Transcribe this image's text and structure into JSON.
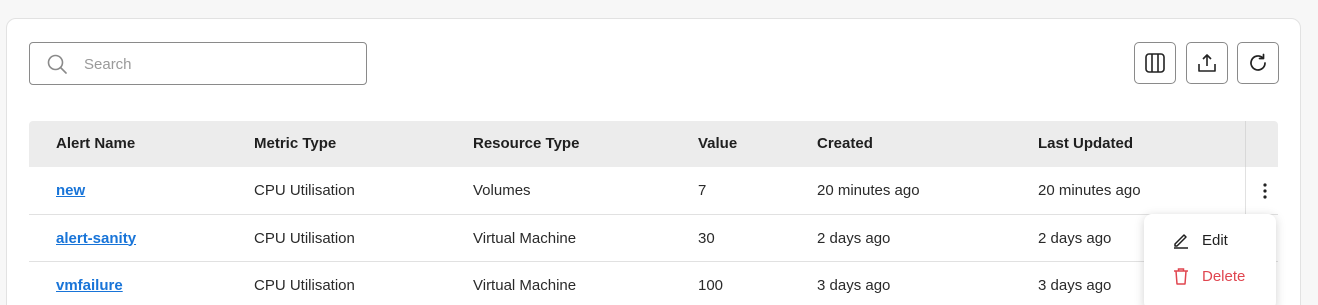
{
  "search": {
    "placeholder": "Search",
    "value": ""
  },
  "toolbar": {
    "columns_icon": "columns-icon",
    "export_icon": "upload-icon",
    "refresh_icon": "refresh-icon"
  },
  "table": {
    "headers": [
      "Alert Name",
      "Metric Type",
      "Resource Type",
      "Value",
      "Created",
      "Last Updated"
    ],
    "rows": [
      [
        "new",
        "CPU Utilisation",
        "Volumes",
        "7",
        "20 minutes ago",
        "20 minutes ago"
      ],
      [
        "alert-sanity",
        "CPU Utilisation",
        "Virtual Machine",
        "30",
        "2 days ago",
        "2 days ago"
      ],
      [
        "vmfailure",
        "CPU Utilisation",
        "Virtual Machine",
        "100",
        "3 days ago",
        "3 days ago"
      ]
    ]
  },
  "row_menu": {
    "edit_label": "Edit",
    "delete_label": "Delete"
  },
  "colors": {
    "link": "#1874d8",
    "danger": "#e0454f",
    "header_bg": "#ececec"
  }
}
